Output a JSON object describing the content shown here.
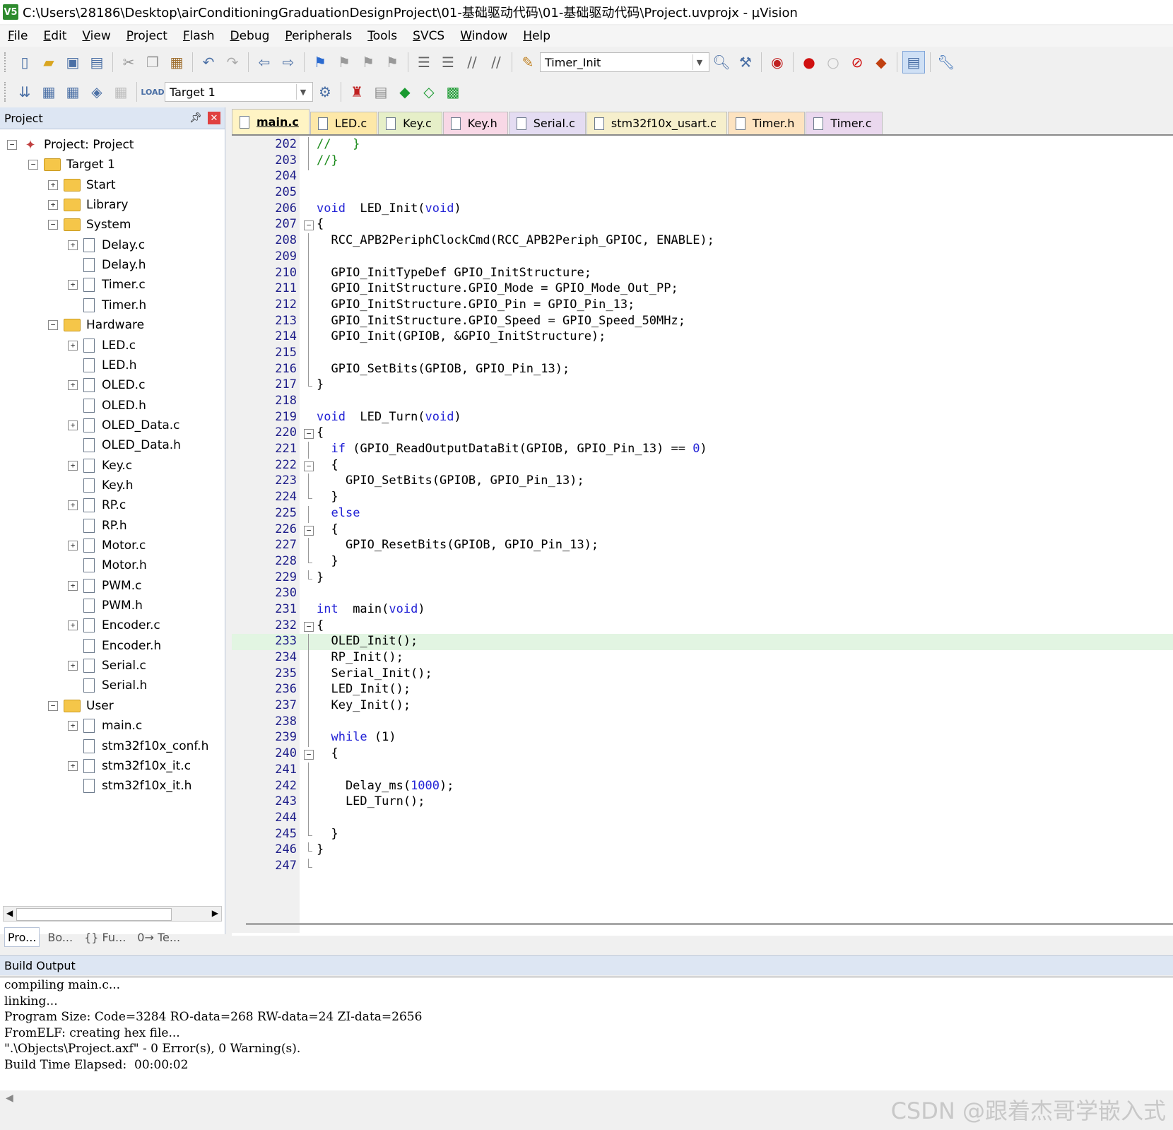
{
  "window": {
    "title": "C:\\Users\\28186\\Desktop\\airConditioningGraduationDesignProject\\01-基础驱动代码\\01-基础驱动代码\\Project.uvprojx - µVision",
    "app_icon": "V5"
  },
  "menu": [
    "File",
    "Edit",
    "View",
    "Project",
    "Flash",
    "Debug",
    "Peripherals",
    "Tools",
    "SVCS",
    "Window",
    "Help"
  ],
  "toolbar": {
    "find_combo_value": "Timer_Init",
    "target_combo_value": "Target 1"
  },
  "project_panel": {
    "title": "Project",
    "tree": [
      {
        "label": "Project: Project",
        "indent": 0,
        "type": "project",
        "exp": "−"
      },
      {
        "label": "Target 1",
        "indent": 1,
        "type": "folder",
        "exp": "−"
      },
      {
        "label": "Start",
        "indent": 2,
        "type": "folder",
        "exp": "+"
      },
      {
        "label": "Library",
        "indent": 2,
        "type": "folder",
        "exp": "+"
      },
      {
        "label": "System",
        "indent": 2,
        "type": "folder",
        "exp": "−"
      },
      {
        "label": "Delay.c",
        "indent": 3,
        "type": "file",
        "exp": "+"
      },
      {
        "label": "Delay.h",
        "indent": 3,
        "type": "file",
        "exp": ""
      },
      {
        "label": "Timer.c",
        "indent": 3,
        "type": "file",
        "exp": "+"
      },
      {
        "label": "Timer.h",
        "indent": 3,
        "type": "file",
        "exp": ""
      },
      {
        "label": "Hardware",
        "indent": 2,
        "type": "folder",
        "exp": "−"
      },
      {
        "label": "LED.c",
        "indent": 3,
        "type": "file",
        "exp": "+"
      },
      {
        "label": "LED.h",
        "indent": 3,
        "type": "file",
        "exp": ""
      },
      {
        "label": "OLED.c",
        "indent": 3,
        "type": "file",
        "exp": "+"
      },
      {
        "label": "OLED.h",
        "indent": 3,
        "type": "file",
        "exp": ""
      },
      {
        "label": "OLED_Data.c",
        "indent": 3,
        "type": "file",
        "exp": "+"
      },
      {
        "label": "OLED_Data.h",
        "indent": 3,
        "type": "file",
        "exp": ""
      },
      {
        "label": "Key.c",
        "indent": 3,
        "type": "file",
        "exp": "+"
      },
      {
        "label": "Key.h",
        "indent": 3,
        "type": "file",
        "exp": ""
      },
      {
        "label": "RP.c",
        "indent": 3,
        "type": "file",
        "exp": "+"
      },
      {
        "label": "RP.h",
        "indent": 3,
        "type": "file",
        "exp": ""
      },
      {
        "label": "Motor.c",
        "indent": 3,
        "type": "file",
        "exp": "+"
      },
      {
        "label": "Motor.h",
        "indent": 3,
        "type": "file",
        "exp": ""
      },
      {
        "label": "PWM.c",
        "indent": 3,
        "type": "file",
        "exp": "+"
      },
      {
        "label": "PWM.h",
        "indent": 3,
        "type": "file",
        "exp": ""
      },
      {
        "label": "Encoder.c",
        "indent": 3,
        "type": "file",
        "exp": "+"
      },
      {
        "label": "Encoder.h",
        "indent": 3,
        "type": "file",
        "exp": ""
      },
      {
        "label": "Serial.c",
        "indent": 3,
        "type": "file",
        "exp": "+"
      },
      {
        "label": "Serial.h",
        "indent": 3,
        "type": "file",
        "exp": ""
      },
      {
        "label": "User",
        "indent": 2,
        "type": "folder",
        "exp": "−"
      },
      {
        "label": "main.c",
        "indent": 3,
        "type": "file",
        "exp": "+"
      },
      {
        "label": "stm32f10x_conf.h",
        "indent": 3,
        "type": "file",
        "exp": ""
      },
      {
        "label": "stm32f10x_it.c",
        "indent": 3,
        "type": "file",
        "exp": "+"
      },
      {
        "label": "stm32f10x_it.h",
        "indent": 3,
        "type": "file",
        "exp": ""
      }
    ],
    "bottom_tabs": [
      "Pro...",
      "Bo...",
      "{} Fu...",
      "0→ Te..."
    ]
  },
  "editor_tabs": [
    {
      "label": "main.c",
      "color": "#fff4c4",
      "active": true
    },
    {
      "label": "LED.c",
      "color": "#fde8a8"
    },
    {
      "label": "Key.c",
      "color": "#e6efc8"
    },
    {
      "label": "Key.h",
      "color": "#f8d8e6"
    },
    {
      "label": "Serial.c",
      "color": "#e4dcf2"
    },
    {
      "label": "stm32f10x_usart.c",
      "color": "#f6efcc"
    },
    {
      "label": "Timer.h",
      "color": "#fde3c0"
    },
    {
      "label": "Timer.c",
      "color": "#ead8ee"
    }
  ],
  "code": [
    {
      "n": "202",
      "fold": "line",
      "t": [
        [
          "cm",
          "//   }"
        ]
      ]
    },
    {
      "n": "203",
      "fold": "line",
      "t": [
        [
          "cm",
          "//}"
        ]
      ]
    },
    {
      "n": "204",
      "fold": "",
      "t": []
    },
    {
      "n": "205",
      "fold": "",
      "t": []
    },
    {
      "n": "206",
      "fold": "",
      "t": [
        [
          "kw",
          "void"
        ],
        [
          "",
          "  LED_Init("
        ],
        [
          "kw",
          "void"
        ],
        [
          "",
          ")"
        ]
      ]
    },
    {
      "n": "207",
      "fold": "box",
      "t": [
        [
          "",
          "{"
        ]
      ]
    },
    {
      "n": "208",
      "fold": "line",
      "t": [
        [
          "",
          "  RCC_APB2PeriphClockCmd(RCC_APB2Periph_GPIOC, ENABLE);"
        ]
      ]
    },
    {
      "n": "209",
      "fold": "line",
      "t": []
    },
    {
      "n": "210",
      "fold": "line",
      "t": [
        [
          "",
          "  GPIO_InitTypeDef GPIO_InitStructure;"
        ]
      ]
    },
    {
      "n": "211",
      "fold": "line",
      "t": [
        [
          "",
          "  GPIO_InitStructure.GPIO_Mode = GPIO_Mode_Out_PP;"
        ]
      ]
    },
    {
      "n": "212",
      "fold": "line",
      "t": [
        [
          "",
          "  GPIO_InitStructure.GPIO_Pin = GPIO_Pin_13;"
        ]
      ]
    },
    {
      "n": "213",
      "fold": "line",
      "t": [
        [
          "",
          "  GPIO_InitStructure.GPIO_Speed = GPIO_Speed_50MHz;"
        ]
      ]
    },
    {
      "n": "214",
      "fold": "line",
      "t": [
        [
          "",
          "  GPIO_Init(GPIOB, &GPIO_InitStructure);"
        ]
      ]
    },
    {
      "n": "215",
      "fold": "line",
      "t": []
    },
    {
      "n": "216",
      "fold": "line",
      "t": [
        [
          "",
          "  GPIO_SetBits(GPIOB, GPIO_Pin_13);"
        ]
      ]
    },
    {
      "n": "217",
      "fold": "end",
      "t": [
        [
          "",
          "}"
        ]
      ]
    },
    {
      "n": "218",
      "fold": "",
      "t": []
    },
    {
      "n": "219",
      "fold": "",
      "t": [
        [
          "kw",
          "void"
        ],
        [
          "",
          "  LED_Turn("
        ],
        [
          "kw",
          "void"
        ],
        [
          "",
          ")"
        ]
      ]
    },
    {
      "n": "220",
      "fold": "box",
      "t": [
        [
          "",
          "{"
        ]
      ]
    },
    {
      "n": "221",
      "fold": "line",
      "t": [
        [
          "",
          "  "
        ],
        [
          "kw",
          "if"
        ],
        [
          "",
          " (GPIO_ReadOutputDataBit(GPIOB, GPIO_Pin_13) == "
        ],
        [
          "num",
          "0"
        ],
        [
          "",
          ")"
        ]
      ]
    },
    {
      "n": "222",
      "fold": "box",
      "t": [
        [
          "",
          "  {"
        ]
      ]
    },
    {
      "n": "223",
      "fold": "line",
      "t": [
        [
          "",
          "    GPIO_SetBits(GPIOB, GPIO_Pin_13);"
        ]
      ]
    },
    {
      "n": "224",
      "fold": "end",
      "t": [
        [
          "",
          "  }"
        ]
      ]
    },
    {
      "n": "225",
      "fold": "line",
      "t": [
        [
          "",
          "  "
        ],
        [
          "kw",
          "else"
        ]
      ]
    },
    {
      "n": "226",
      "fold": "box",
      "t": [
        [
          "",
          "  {"
        ]
      ]
    },
    {
      "n": "227",
      "fold": "line",
      "t": [
        [
          "",
          "    GPIO_ResetBits(GPIOB, GPIO_Pin_13);"
        ]
      ]
    },
    {
      "n": "228",
      "fold": "end",
      "t": [
        [
          "",
          "  }"
        ]
      ]
    },
    {
      "n": "229",
      "fold": "end",
      "t": [
        [
          "",
          "}"
        ]
      ]
    },
    {
      "n": "230",
      "fold": "",
      "t": []
    },
    {
      "n": "231",
      "fold": "",
      "t": [
        [
          "kw",
          "int"
        ],
        [
          "",
          "  main("
        ],
        [
          "kw",
          "void"
        ],
        [
          "",
          ")"
        ]
      ]
    },
    {
      "n": "232",
      "fold": "box",
      "t": [
        [
          "",
          "{"
        ]
      ]
    },
    {
      "n": "233",
      "fold": "line",
      "hl": true,
      "t": [
        [
          "",
          "  OLED_Init();"
        ]
      ]
    },
    {
      "n": "234",
      "fold": "line",
      "t": [
        [
          "",
          "  RP_Init();"
        ]
      ]
    },
    {
      "n": "235",
      "fold": "line",
      "t": [
        [
          "",
          "  Serial_Init();"
        ]
      ]
    },
    {
      "n": "236",
      "fold": "line",
      "t": [
        [
          "",
          "  LED_Init();"
        ]
      ]
    },
    {
      "n": "237",
      "fold": "line",
      "t": [
        [
          "",
          "  Key_Init();"
        ]
      ]
    },
    {
      "n": "238",
      "fold": "line",
      "t": []
    },
    {
      "n": "239",
      "fold": "line",
      "t": [
        [
          "",
          "  "
        ],
        [
          "kw",
          "while"
        ],
        [
          "",
          " (1)"
        ]
      ]
    },
    {
      "n": "240",
      "fold": "box",
      "t": [
        [
          "",
          "  {"
        ]
      ]
    },
    {
      "n": "241",
      "fold": "line",
      "t": []
    },
    {
      "n": "242",
      "fold": "line",
      "t": [
        [
          "",
          "    Delay_ms("
        ],
        [
          "num",
          "1000"
        ],
        [
          "",
          ");"
        ]
      ]
    },
    {
      "n": "243",
      "fold": "line",
      "t": [
        [
          "",
          "    LED_Turn();"
        ]
      ]
    },
    {
      "n": "244",
      "fold": "line",
      "t": []
    },
    {
      "n": "245",
      "fold": "end",
      "t": [
        [
          "",
          "  }"
        ]
      ]
    },
    {
      "n": "246",
      "fold": "end",
      "t": [
        [
          "",
          "}"
        ]
      ]
    },
    {
      "n": "247",
      "fold": "end",
      "t": []
    }
  ],
  "build_output": {
    "title": "Build Output",
    "lines": [
      "compiling main.c...",
      "linking...",
      "Program Size: Code=3284 RO-data=268 RW-data=24 ZI-data=2656",
      "FromELF: creating hex file...",
      "\".\\Objects\\Project.axf\" - 0 Error(s), 0 Warning(s).",
      "Build Time Elapsed:  00:00:02"
    ]
  },
  "watermark": "CSDN @跟着杰哥学嵌入式"
}
